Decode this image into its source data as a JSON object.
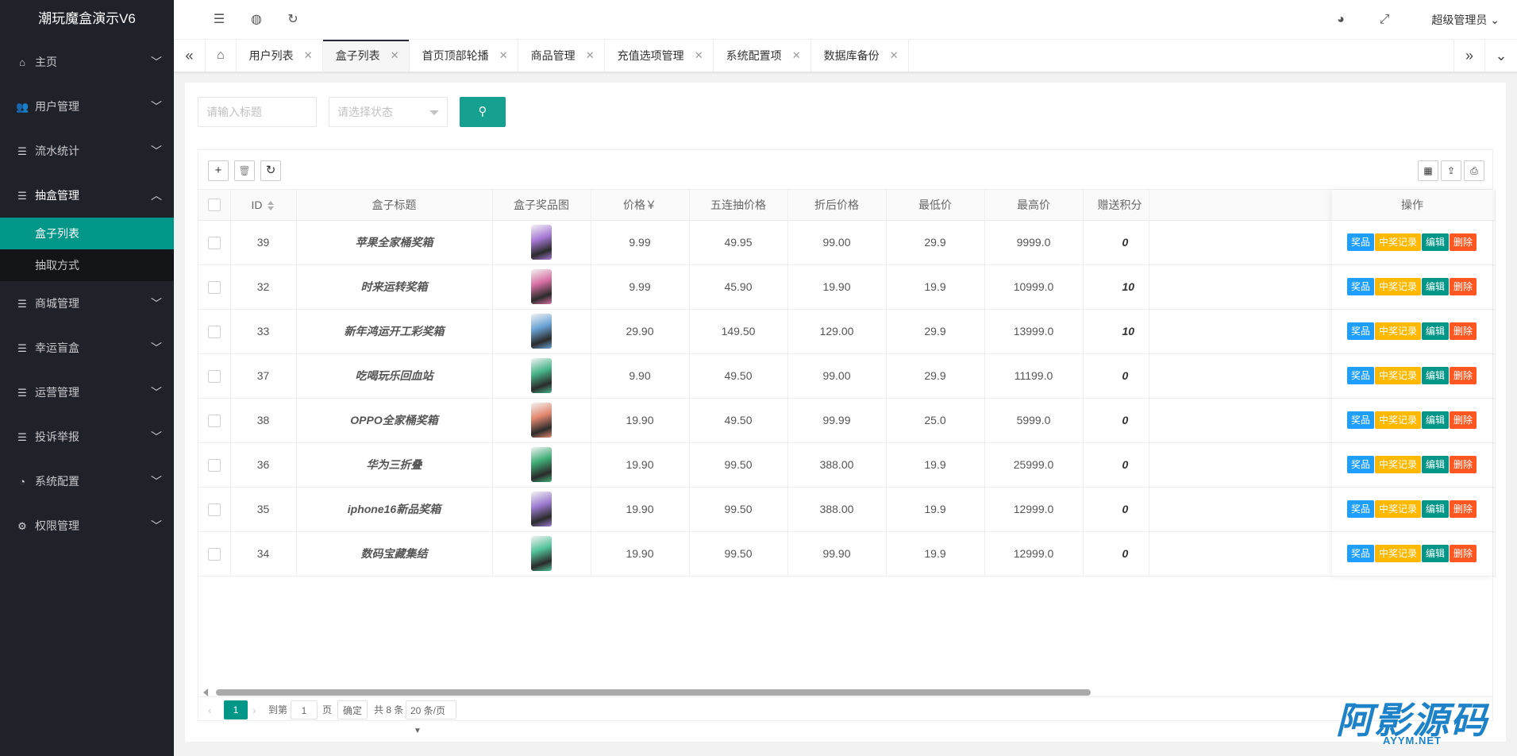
{
  "app": {
    "title": "潮玩魔盒演示V6"
  },
  "sidebar": {
    "items": [
      {
        "label": "主页",
        "icon": "home-icon"
      },
      {
        "label": "用户管理",
        "icon": "users-icon"
      },
      {
        "label": "流水统计",
        "icon": "list-icon"
      },
      {
        "label": "抽盒管理",
        "icon": "list-icon",
        "open": true,
        "children": [
          {
            "label": "盒子列表",
            "active": true
          },
          {
            "label": "抽取方式"
          }
        ]
      },
      {
        "label": "商城管理",
        "icon": "list-icon"
      },
      {
        "label": "幸运盲盒",
        "icon": "list-icon"
      },
      {
        "label": "运营管理",
        "icon": "list-icon"
      },
      {
        "label": "投诉举报",
        "icon": "list-icon"
      },
      {
        "label": "系统配置",
        "icon": "settings-icon"
      },
      {
        "label": "权限管理",
        "icon": "gear-icon"
      }
    ]
  },
  "header": {
    "user": "超级管理员"
  },
  "tabs": [
    {
      "label": "用户列表"
    },
    {
      "label": "盒子列表",
      "active": true
    },
    {
      "label": "首页顶部轮播"
    },
    {
      "label": "商品管理"
    },
    {
      "label": "充值选项管理"
    },
    {
      "label": "系统配置项"
    },
    {
      "label": "数据库备份"
    }
  ],
  "filters": {
    "title_placeholder": "请输入标题",
    "status_placeholder": "请选择状态"
  },
  "table": {
    "columns": {
      "id": "ID",
      "title": "盒子标题",
      "image": "盒子奖品图",
      "price": "价格￥",
      "five": "五连抽价格",
      "discount": "折后价格",
      "min": "最低价",
      "max": "最高价",
      "points": "赠送积分",
      "actions": "操作"
    },
    "action_labels": {
      "prize": "奖品",
      "record": "中奖记录",
      "edit": "编辑",
      "delete": "删除"
    },
    "rows": [
      {
        "id": "39",
        "title": "苹果全家桶奖箱",
        "price": "9.99",
        "five": "49.95",
        "discount": "99.00",
        "min": "29.9",
        "max": "9999.0",
        "points": "0",
        "thumb": "#a879d6"
      },
      {
        "id": "32",
        "title": "时来运转奖箱",
        "price": "9.99",
        "five": "45.90",
        "discount": "19.90",
        "min": "19.9",
        "max": "10999.0",
        "points": "10",
        "thumb": "#d66fa3"
      },
      {
        "id": "33",
        "title": "新年鸿运开工彩奖箱",
        "price": "29.90",
        "five": "149.50",
        "discount": "129.00",
        "min": "29.9",
        "max": "13999.0",
        "points": "10",
        "thumb": "#6aa3d6"
      },
      {
        "id": "37",
        "title": "吃喝玩乐回血站",
        "price": "9.90",
        "five": "49.50",
        "discount": "99.00",
        "min": "29.9",
        "max": "11199.0",
        "points": "0",
        "thumb": "#47b58a"
      },
      {
        "id": "38",
        "title": "OPPO全家桶奖箱",
        "price": "19.90",
        "five": "49.50",
        "discount": "99.99",
        "min": "25.0",
        "max": "5999.0",
        "points": "0",
        "thumb": "#e2876e"
      },
      {
        "id": "36",
        "title": "华为三折叠",
        "price": "19.90",
        "five": "99.50",
        "discount": "388.00",
        "min": "19.9",
        "max": "25999.0",
        "points": "0",
        "thumb": "#3fae76"
      },
      {
        "id": "35",
        "title": "iphone16新品奖箱",
        "price": "19.90",
        "five": "99.50",
        "discount": "388.00",
        "min": "19.9",
        "max": "12999.0",
        "points": "0",
        "thumb": "#9c7bd1"
      },
      {
        "id": "34",
        "title": "数码宝藏集结",
        "price": "19.90",
        "five": "99.50",
        "discount": "99.90",
        "min": "19.9",
        "max": "12999.0",
        "points": "0",
        "thumb": "#52c29a"
      }
    ]
  },
  "pagination": {
    "current": "1",
    "goto_label": "到第",
    "page_value": "1",
    "page_unit": "页",
    "confirm": "确定",
    "total": "共 8 条",
    "page_size": "20 条/页"
  },
  "watermark": {
    "big": "阿影源码",
    "small": "AYYM.NET"
  }
}
